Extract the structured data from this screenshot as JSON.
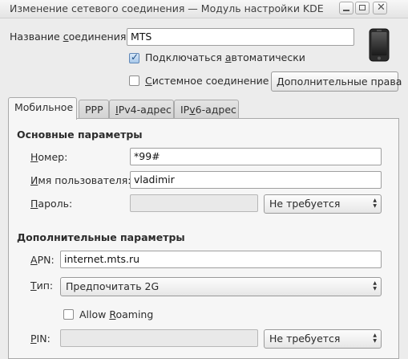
{
  "window": {
    "title": "Изменение сетевого соединения — Модуль настройки KDE"
  },
  "connection": {
    "name_label_pre": "Название ",
    "name_label_u": "с",
    "name_label_post": "оединения:",
    "name_value": "MTS",
    "auto_connect": {
      "pre": "Подключаться ",
      "u": "а",
      "post": "втоматически",
      "checked": true
    },
    "system_conn": {
      "pre": "",
      "u": "С",
      "post": "истемное соединение",
      "checked": false
    },
    "advanced_rights_button": "Дополнительные права"
  },
  "tabs": [
    {
      "pre": "",
      "u": "",
      "post": "Мобильное",
      "active": true
    },
    {
      "pre": "",
      "u": "",
      "post": "PPP",
      "active": false
    },
    {
      "pre": "",
      "u": "I",
      "post": "Pv4-адрес",
      "active": false
    },
    {
      "pre": "IP",
      "u": "v",
      "post": "6-адрес",
      "active": false
    }
  ],
  "basic": {
    "heading": "Основные параметры",
    "number": {
      "pre": "",
      "u": "Н",
      "post": "омер:",
      "value": "*99#"
    },
    "username": {
      "pre": "",
      "u": "И",
      "post": "мя пользователя:",
      "value": "vladimir"
    },
    "password": {
      "pre": "",
      "u": "П",
      "post": "ароль:",
      "value": "",
      "option": "Не требуется"
    }
  },
  "extra": {
    "heading": "Дополнительные параметры",
    "apn": {
      "pre": "",
      "u": "A",
      "post": "PN:",
      "value": "internet.mts.ru"
    },
    "type": {
      "pre": "",
      "u": "Т",
      "post": "ип:",
      "value": "Предпочитать 2G"
    },
    "roaming": {
      "pre": "Allow ",
      "u": "R",
      "post": "oaming",
      "checked": false
    },
    "pin": {
      "pre": "",
      "u": "P",
      "post": "IN:",
      "value": "",
      "option": "Не требуется"
    }
  },
  "icons": {
    "phone": "mobile-phone-icon"
  }
}
